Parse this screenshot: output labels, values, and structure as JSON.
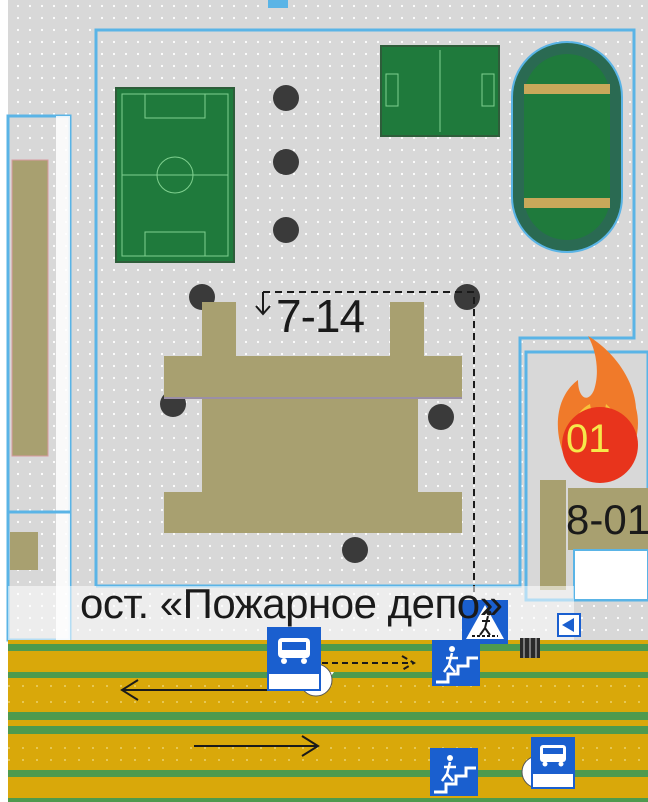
{
  "map": {
    "building_number": "7-14",
    "fire_station_number": "01",
    "right_building_number": "8-01",
    "bus_stop_label": "ост. «Пожарное депо»"
  },
  "icons": [
    "football-field-icon",
    "mini-football-field-icon",
    "running-track-icon",
    "fire-station-icon",
    "bus-stop-icon",
    "pedestrian-crossing-icon",
    "underground-passage-icon",
    "direction-arrow-icon",
    "bollard-icon"
  ],
  "colors": {
    "background": "#d8d8d8",
    "road": "#d9a80a",
    "median": "#4e9a4e",
    "building": "#a8a070",
    "field": "#1f7a3c",
    "block_outline": "#5ab4e6",
    "tree": "#3a3a3a",
    "fire": "#e8341c",
    "sign_blue": "#1a5fcf"
  }
}
